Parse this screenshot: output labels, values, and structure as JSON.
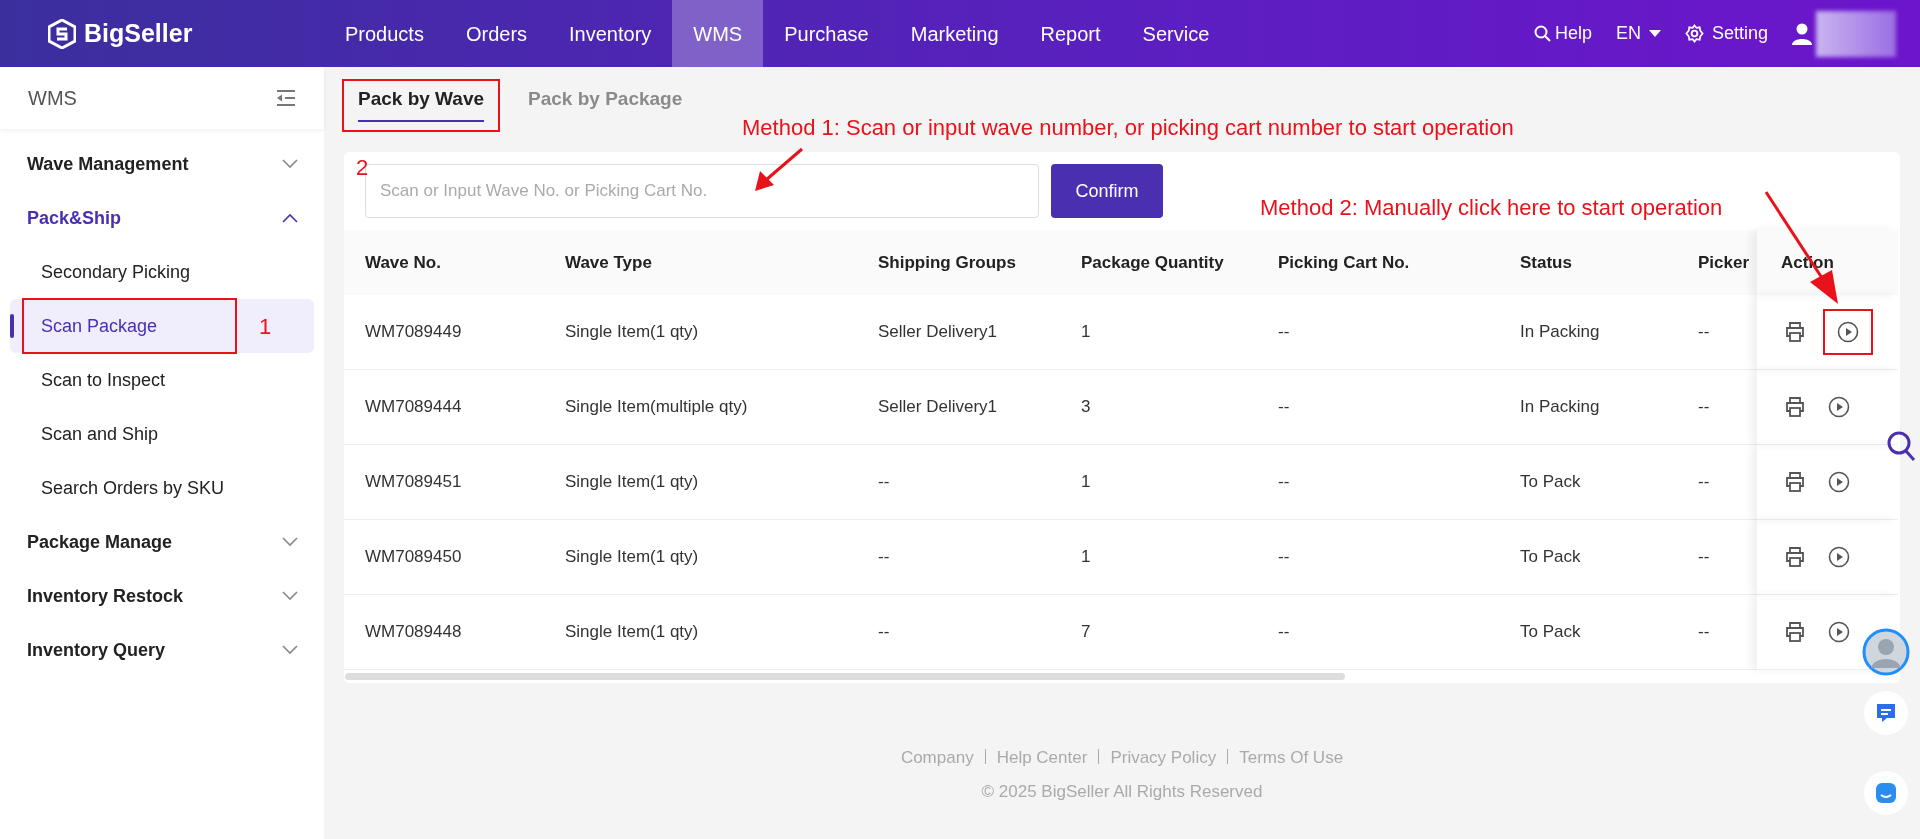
{
  "navbar": {
    "logo": "BigSeller",
    "items": [
      {
        "label": "Products",
        "selected": false
      },
      {
        "label": "Orders",
        "selected": false
      },
      {
        "label": "Inventory",
        "selected": false
      },
      {
        "label": "WMS",
        "selected": true
      },
      {
        "label": "Purchase",
        "selected": false
      },
      {
        "label": "Marketing",
        "selected": false
      },
      {
        "label": "Report",
        "selected": false
      },
      {
        "label": "Service",
        "selected": false
      }
    ],
    "help": "Help",
    "language": "EN",
    "setting": "Setting"
  },
  "sidebar": {
    "title": "WMS",
    "groups": [
      {
        "label": "Wave Management",
        "expanded": false,
        "active": false
      },
      {
        "label": "Pack&Ship",
        "expanded": true,
        "active": true,
        "children": [
          {
            "label": "Secondary Picking",
            "selected": false
          },
          {
            "label": "Scan Package",
            "selected": true,
            "marker": "1"
          },
          {
            "label": "Scan to Inspect",
            "selected": false
          },
          {
            "label": "Scan and Ship",
            "selected": false
          },
          {
            "label": "Search Orders by SKU",
            "selected": false
          }
        ]
      },
      {
        "label": "Package Manage",
        "expanded": false,
        "active": false
      },
      {
        "label": "Inventory Restock",
        "expanded": false,
        "active": false
      },
      {
        "label": "Inventory Query",
        "expanded": false,
        "active": false
      }
    ]
  },
  "tabs": [
    {
      "label": "Pack by Wave",
      "selected": true,
      "marker": "2"
    },
    {
      "label": "Pack by Package",
      "selected": false
    }
  ],
  "scan": {
    "placeholder": "Scan or Input Wave No. or Picking Cart No.",
    "button": "Confirm"
  },
  "table": {
    "columns": [
      "Wave No.",
      "Wave Type",
      "Shipping Groups",
      "Package Quantity",
      "Picking Cart No.",
      "Status",
      "Picker",
      "Action"
    ],
    "rows": [
      {
        "cells": [
          "WM7089449",
          "Single Item(1 qty)",
          "Seller Delivery1",
          "1",
          "--",
          "In Packing",
          "--"
        ],
        "start_highlighted": true
      },
      {
        "cells": [
          "WM7089444",
          "Single Item(multiple qty)",
          "Seller Delivery1",
          "3",
          "--",
          "In Packing",
          "--"
        ],
        "start_highlighted": false
      },
      {
        "cells": [
          "WM7089451",
          "Single Item(1 qty)",
          "--",
          "1",
          "--",
          "To Pack",
          "--"
        ],
        "start_highlighted": false
      },
      {
        "cells": [
          "WM7089450",
          "Single Item(1 qty)",
          "--",
          "1",
          "--",
          "To Pack",
          "--"
        ],
        "start_highlighted": false
      },
      {
        "cells": [
          "WM7089448",
          "Single Item(1 qty)",
          "--",
          "7",
          "--",
          "To Pack",
          "--"
        ],
        "start_highlighted": false
      }
    ]
  },
  "footer": {
    "links": [
      "Company",
      "Help Center",
      "Privacy Policy",
      "Terms Of Use"
    ],
    "copyright": "© 2025 BigSeller All Rights Reserved"
  },
  "annotations": [
    {
      "kind": "method1",
      "text": "Method 1: Scan or input wave number, or picking cart number to start operation"
    },
    {
      "kind": "method2",
      "text": "Method 2: Manually click here to start operation"
    }
  ]
}
